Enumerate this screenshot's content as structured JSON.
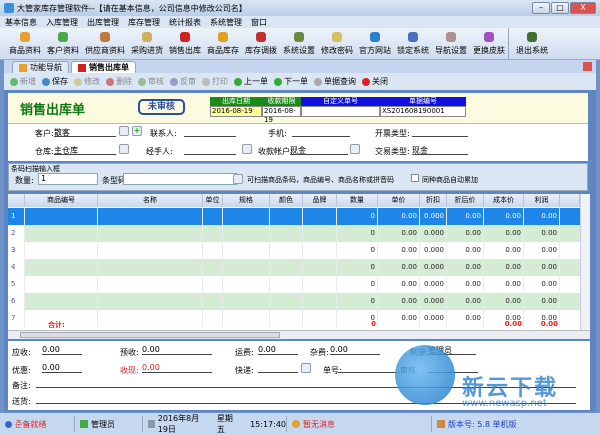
{
  "window": {
    "title": "大管家库存管理软件--【请在基本信息，公司信息中修改公司名】",
    "min": "–",
    "max": "□",
    "close": "X"
  },
  "menu": [
    "基本信息",
    "入库管理",
    "出库管理",
    "库存管理",
    "统计报表",
    "系统管理",
    "窗口"
  ],
  "toolbar": [
    {
      "label": "商品资料",
      "color": "#e8a030"
    },
    {
      "label": "客户资料",
      "color": "#4aa84a"
    },
    {
      "label": "供应商资料",
      "color": "#c07a40"
    },
    {
      "label": "采购进货",
      "color": "#d0b060"
    },
    {
      "label": "销售出库",
      "color": "#d02020"
    },
    {
      "label": "商品库存",
      "color": "#e0a020"
    },
    {
      "label": "库存调拨",
      "color": "#c03030"
    },
    {
      "label": "系统设置",
      "color": "#6a8a40"
    },
    {
      "label": "修改密码",
      "color": "#d8c060"
    },
    {
      "label": "官方网站",
      "color": "#2a80d0"
    },
    {
      "label": "锁定系统",
      "color": "#4a70c0"
    },
    {
      "label": "导航设置",
      "color": "#b09090"
    },
    {
      "label": "更换皮肤",
      "color": "#a050c0"
    },
    {
      "label": "退出系统",
      "color": "#407030"
    }
  ],
  "tabs": [
    {
      "label": "功能导航"
    },
    {
      "label": "销售出库单"
    }
  ],
  "actions": [
    {
      "label": "新增",
      "on": false,
      "color": "#6b6"
    },
    {
      "label": "保存",
      "on": true,
      "color": "#48c"
    },
    {
      "label": "修改",
      "on": false,
      "color": "#cc9"
    },
    {
      "label": "删除",
      "on": false,
      "color": "#c77"
    },
    {
      "label": "审核",
      "on": false,
      "color": "#9b9"
    },
    {
      "label": "反审",
      "on": false,
      "color": "#99c"
    },
    {
      "label": "打印",
      "on": false,
      "color": "#bbb"
    },
    {
      "label": "上一单",
      "on": true,
      "color": "#3a3"
    },
    {
      "label": "下一单",
      "on": true,
      "color": "#3a3"
    },
    {
      "label": "单据查询",
      "on": true,
      "color": "#aaa"
    },
    {
      "label": "关闭",
      "on": true,
      "color": "#d22"
    }
  ],
  "form": {
    "title": "销售出库单",
    "status": "未审核",
    "header": [
      {
        "label": "出库日期",
        "value": "2016-08-19",
        "lcolor": "#1a8a1a",
        "vcolor": "#ffff99"
      },
      {
        "label": "收款期限",
        "value": "2016-08-19",
        "lcolor": "#1a8a1a",
        "vcolor": "#ffffff"
      },
      {
        "label": "自定义单号",
        "value": "",
        "lcolor": "#1010e0",
        "vcolor": "#ffffff"
      },
      {
        "label": "单据编号",
        "value": "XS201608190001",
        "lcolor": "#1010e0",
        "vcolor": "#ffffff"
      }
    ],
    "customer_label": "客户:",
    "customer": "散客",
    "contact_label": "联系人:",
    "contact": "",
    "phone_label": "手机:",
    "phone": "",
    "invoice_label": "开票类型:",
    "invoice": "",
    "warehouse_label": "仓库:",
    "warehouse": "主仓库",
    "handler_label": "经手人:",
    "handler": "",
    "account_label": "收款帐户:",
    "account": "现金",
    "trade_label": "交易类型:",
    "trade": "现金"
  },
  "scan": {
    "title": "条码扫描输入框",
    "qty_label": "数量:",
    "qty": "1",
    "barcode_label": "条型码:",
    "barcode": "",
    "hint": "可扫描商品条码，商品编号、商品名称或拼音码",
    "auto_label": "同种商品自动累加",
    "auto": false
  },
  "grid": {
    "columns": [
      "商品编号",
      "名称",
      "单位",
      "规格",
      "颜色",
      "品牌",
      "数量",
      "单价",
      "折扣",
      "折后价",
      "成本价",
      "利润"
    ],
    "rows": [
      {
        "n": "1",
        "qty": "0",
        "price": "0.00",
        "disc": "0.000",
        "after": "0.00",
        "cost": "0.00",
        "profit": "0.00"
      },
      {
        "n": "2",
        "qty": "0",
        "price": "0.00",
        "disc": "0.000",
        "after": "0.00",
        "cost": "0.00",
        "profit": "0.00"
      },
      {
        "n": "3",
        "qty": "0",
        "price": "0.00",
        "disc": "0.000",
        "after": "0.00",
        "cost": "0.00",
        "profit": "0.00"
      },
      {
        "n": "4",
        "qty": "0",
        "price": "0.00",
        "disc": "0.000",
        "after": "0.00",
        "cost": "0.00",
        "profit": "0.00"
      },
      {
        "n": "5",
        "qty": "0",
        "price": "0.00",
        "disc": "0.000",
        "after": "0.00",
        "cost": "0.00",
        "profit": "0.00"
      },
      {
        "n": "6",
        "qty": "0",
        "price": "0.00",
        "disc": "0.000",
        "after": "0.00",
        "cost": "0.00",
        "profit": "0.00"
      },
      {
        "n": "7",
        "qty": "0",
        "price": "0.00",
        "disc": "0.000",
        "after": "0.00",
        "cost": "0.00",
        "profit": "0.00"
      }
    ],
    "total": {
      "label": "合计:",
      "qty": "0",
      "cost": "0.00",
      "profit": "0.00"
    }
  },
  "footer": {
    "receivable_label": "应收:",
    "receivable": "0.00",
    "prepaid_label": "预收:",
    "prepaid": "0.00",
    "freight_label": "运费:",
    "freight": "0.00",
    "misc_label": "杂费:",
    "misc": "0.00",
    "maker_label": "制单:",
    "maker": "管理员",
    "discount_label": "优惠:",
    "discount": "0.00",
    "cash_label": "收现:",
    "cash": "0.00",
    "express_label": "快递:",
    "express": "",
    "waybill_label": "单号:",
    "waybill": "",
    "auditor_label": "审核:",
    "auditor": "",
    "remark_label": "备注:",
    "remark": "",
    "ship_label": "送货:",
    "ship": ""
  },
  "watermark": {
    "text": "新云下载",
    "url": "www.newasp.net"
  },
  "status": {
    "ready": "준备就绪",
    "user": "管理员",
    "date": "2016年8月19日",
    "weekday": "星期五",
    "time": "15:17:40",
    "msg": "暂无消息",
    "version": "版本号: 5.8 单机版"
  }
}
